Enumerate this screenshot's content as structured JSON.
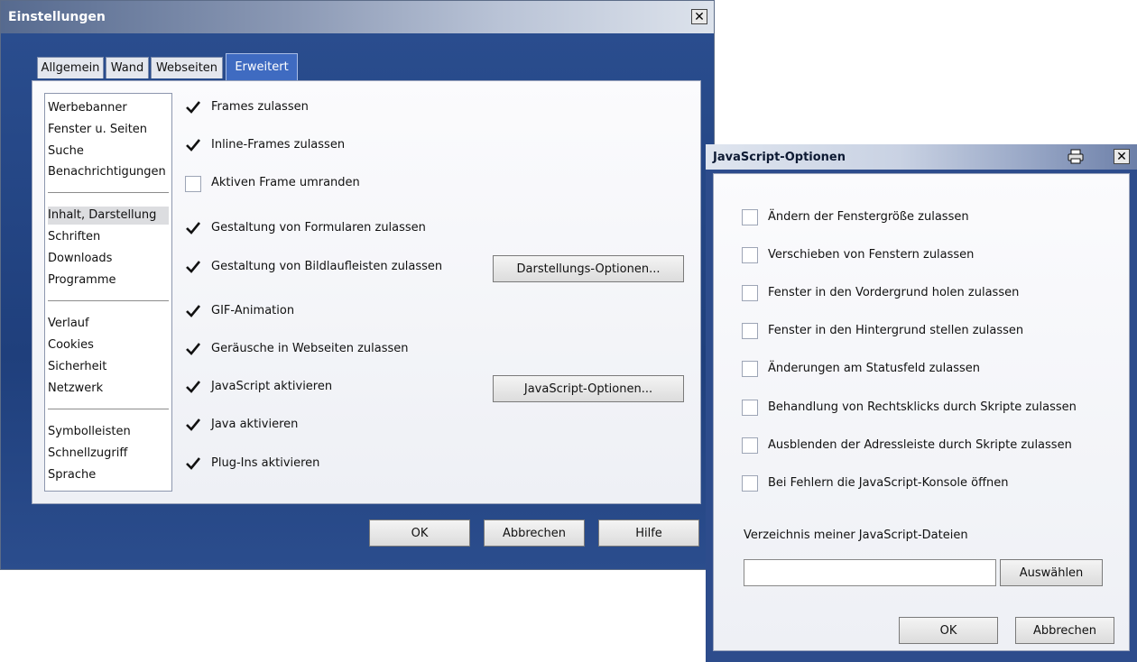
{
  "main_window": {
    "title": "Einstellungen",
    "close_glyph": "✕",
    "tabs": [
      {
        "label": "Allgemein"
      },
      {
        "label": "Wand"
      },
      {
        "label": "Webseiten"
      },
      {
        "label": "Erweitert",
        "active": true
      }
    ],
    "nav": {
      "groups": [
        [
          "Werbebanner",
          "Fenster u. Seiten",
          "Suche",
          "Benachrichtigungen"
        ],
        [
          "Inhalt, Darstellung",
          "Schriften",
          "Downloads",
          "Programme"
        ],
        [
          "Verlauf",
          "Cookies",
          "Sicherheit",
          "Netzwerk"
        ],
        [
          "Symbolleisten",
          "Schnellzugriff",
          "Sprache"
        ]
      ],
      "selected": "Inhalt, Darstellung"
    },
    "options": [
      {
        "label": "Frames zulassen",
        "checked": true
      },
      {
        "label": "Inline-Frames zulassen",
        "checked": true
      },
      {
        "label": "Aktiven Frame umranden",
        "checked": false
      },
      {
        "label": "Gestaltung von Formularen zulassen",
        "checked": true
      },
      {
        "label": "Gestaltung von Bildlaufleisten zulassen",
        "checked": true
      },
      {
        "label": "GIF-Animation",
        "checked": true
      },
      {
        "label": "Geräusche in Webseiten zulassen",
        "checked": true
      },
      {
        "label": "JavaScript aktivieren",
        "checked": true
      },
      {
        "label": "Java aktivieren",
        "checked": true
      },
      {
        "label": "Plug-Ins aktivieren",
        "checked": true
      }
    ],
    "darstellung_button": "Darstellungs-Optionen...",
    "javascript_button": "JavaScript-Optionen...",
    "ok": "OK",
    "cancel": "Abbrechen",
    "help": "Hilfe"
  },
  "js_window": {
    "title": "JavaScript-Optionen",
    "close_glyph": "✕",
    "options": [
      {
        "label": "Ändern der Fenstergröße zulassen",
        "checked": false
      },
      {
        "label": "Verschieben von Fenstern zulassen",
        "checked": false
      },
      {
        "label": "Fenster in den Vordergrund holen zulassen",
        "checked": false
      },
      {
        "label": "Fenster in den Hintergrund stellen zulassen",
        "checked": false
      },
      {
        "label": "Änderungen am Statusfeld zulassen",
        "checked": false
      },
      {
        "label": "Behandlung von Rechtsklicks durch Skripte zulassen",
        "checked": false
      },
      {
        "label": "Ausblenden der Adressleiste durch Skripte zulassen",
        "checked": false
      },
      {
        "label": "Bei Fehlern die JavaScript-Konsole öffnen",
        "checked": false
      }
    ],
    "folder_label": "Verzeichnis meiner JavaScript-Dateien",
    "folder_value": "",
    "choose_button": "Auswählen",
    "ok": "OK",
    "cancel": "Abbrechen",
    "colors": {
      "window_blue": "#2c4a86",
      "tab_active": "#3f6bc1"
    }
  }
}
